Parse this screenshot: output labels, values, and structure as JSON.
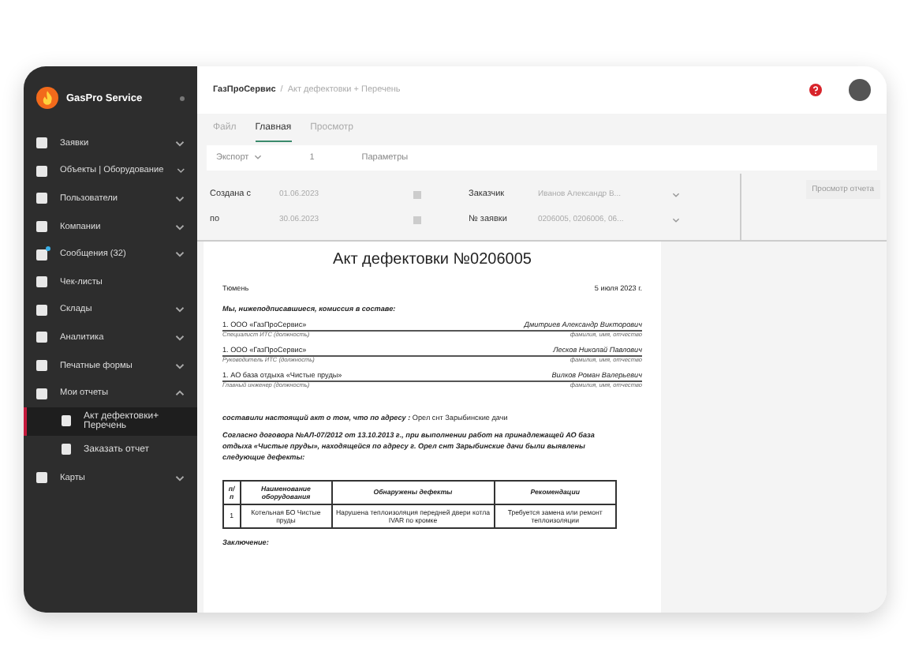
{
  "sidebar": {
    "brand": "GasPro Service",
    "items": [
      {
        "label": "Заявки",
        "expanded": false
      },
      {
        "label": "Объекты | Оборудование",
        "expanded": false
      },
      {
        "label": "Пользователи",
        "expanded": false
      },
      {
        "label": "Компании",
        "expanded": false
      },
      {
        "label": "Сообщения (32)",
        "expanded": false,
        "badge": true
      },
      {
        "label": "Чек-листы"
      },
      {
        "label": "Склады",
        "expanded": false
      },
      {
        "label": "Аналитика",
        "expanded": false
      },
      {
        "label": "Печатные формы",
        "expanded": false
      },
      {
        "label": "Мои отчеты",
        "expanded": true,
        "children": [
          {
            "label": "Акт дефектовки+ Перечень",
            "selected": true
          },
          {
            "label": "Заказать отчет",
            "selected": false
          }
        ]
      },
      {
        "label": "Карты",
        "expanded": false
      }
    ]
  },
  "breadcrumb": {
    "root": "ГазПроСервис",
    "separator": "/",
    "current": "Акт дефектовки + Перечень"
  },
  "tabs": [
    {
      "label": "Файл",
      "selected": false
    },
    {
      "label": "Главная",
      "selected": true
    },
    {
      "label": "Просмотр",
      "selected": false
    }
  ],
  "toolbar": {
    "export": "Экспорт",
    "page": "1",
    "parameters": "Параметры"
  },
  "filters": [
    {
      "label": "Создана с",
      "value": "01.06.2023",
      "kind": "date"
    },
    {
      "label": "Заказчик",
      "value": "Иванов Александр В...",
      "kind": "select"
    },
    {
      "label": "по",
      "value": "30.06.2023",
      "kind": "date"
    },
    {
      "label": "№ заявки",
      "value": "0206005, 0206006, 06...",
      "kind": "select"
    }
  ],
  "preview_button": "Просмотр отчета",
  "document": {
    "title": "Акт дефектовки №0206005",
    "city": "Тюмень",
    "date": "5 июля 2023 г.",
    "commission_heading": "Мы, нижеподписавшиеся, комиссия в составе:",
    "members": [
      {
        "number": "1.",
        "organization": "ООО «ГазПроСервис»",
        "name": "Дмитриев Александр Викторович",
        "position": "Специалист ИТС (должность)",
        "caption": "фамилия, имя, отчество"
      },
      {
        "number": "1.",
        "organization": "ООО «ГазПроСервис»",
        "name": "Лесков Николай Павлович",
        "position": "Руководитель ИТС (должность)",
        "caption": "фамилия, имя, отчество"
      },
      {
        "number": "1.",
        "organization": "АО база отдыха «Чистые пруды»",
        "name": "Вилков Роман Валерьевич",
        "position": "Главный инженер (должность)",
        "caption": "фамилия, имя, отчество"
      }
    ],
    "statement": "**составили настоящий акт о том, что по адресу :** Орел снт Зарыбинские дачи",
    "contract": "Согласно договора №АЛ-07/2012 от 13.10.2013 г., при выполнении работ на принадлежащей АО база отдыха «Чистые пруды», находящейся по адресу г. Орел снт Зарыбинские дачи были выявлены следующие дефекты:",
    "table": {
      "columns": [
        "п/п",
        "Наименование оборудования",
        "Обнаружены дефекты",
        "Рекомендации"
      ],
      "rows": [
        [
          "1",
          "Котельная БО Чистые пруды",
          "Нарушена теплоизоляция передней двери котла IVAR по кромке",
          "Требуется замена или ремонт теплоизоляции"
        ]
      ]
    },
    "conclusion": "Заключение:"
  }
}
